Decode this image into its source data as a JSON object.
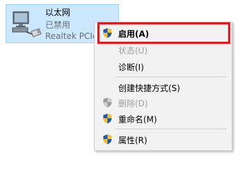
{
  "adapter": {
    "name": "以太网",
    "status": "已禁用",
    "device": "Realtek PCIe",
    "icon": "network-adapter-icon"
  },
  "context_menu": {
    "items": [
      {
        "label": "启用(A)",
        "icon": "uac-shield-icon",
        "bold": true,
        "enabled": true
      },
      {
        "label": "状态(U)",
        "enabled": false
      },
      {
        "label": "诊断(I)",
        "enabled": true
      },
      {
        "label": "创建快捷方式(S)",
        "enabled": true
      },
      {
        "label": "删除(D)",
        "icon": "uac-shield-icon",
        "enabled": false
      },
      {
        "label": "重命名(M)",
        "icon": "uac-shield-icon",
        "enabled": true
      },
      {
        "label": "属性(R)",
        "icon": "uac-shield-icon",
        "enabled": true
      }
    ]
  },
  "highlight_color": "#e0191e",
  "selection_color": "#cce8ff"
}
